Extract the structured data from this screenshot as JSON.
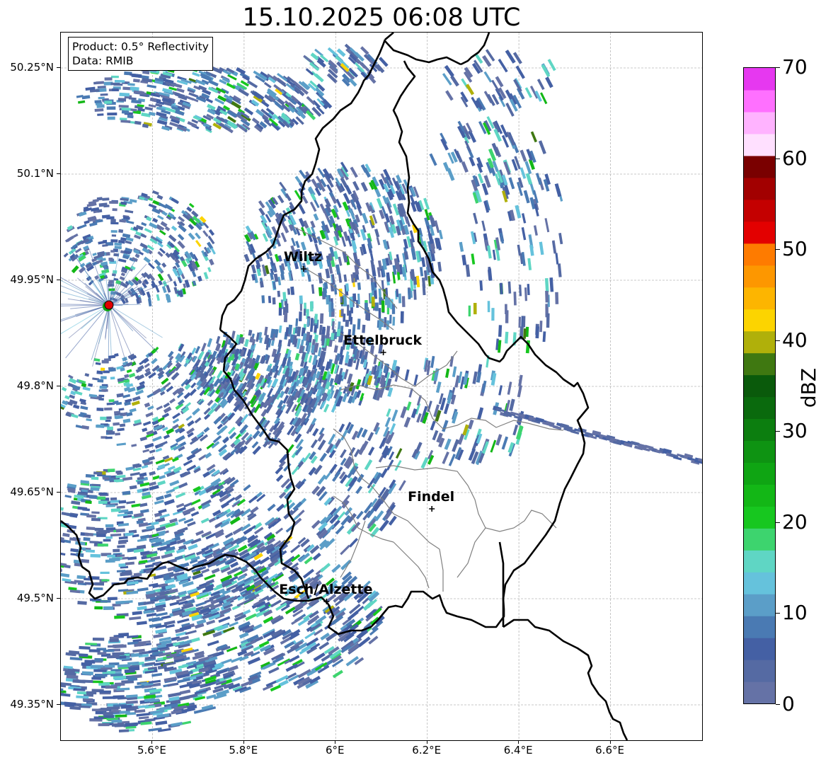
{
  "title": "15.10.2025 06:08 UTC",
  "info": {
    "product": "Product: 0.5° Reflectivity",
    "data": "Data: RMIB"
  },
  "axes": {
    "lat_labels": [
      "50.25°N",
      "50.1°N",
      "49.95°N",
      "49.8°N",
      "49.65°N",
      "49.5°N",
      "49.35°N"
    ],
    "lat_values": [
      50.25,
      50.1,
      49.95,
      49.8,
      49.65,
      49.5,
      49.35
    ],
    "lon_labels": [
      "5.6°E",
      "5.8°E",
      "6°E",
      "6.2°E",
      "6.4°E",
      "6.6°E"
    ],
    "lon_values": [
      5.6,
      5.8,
      6.0,
      6.2,
      6.4,
      6.6
    ],
    "lon_range": [
      5.4,
      6.8
    ],
    "lat_range": [
      49.3,
      50.3
    ],
    "grid": true
  },
  "colorbar": {
    "label": "dBZ",
    "min": 0,
    "max": 70,
    "step": 2.5,
    "tick_labels": [
      "0",
      "10",
      "20",
      "30",
      "40",
      "50",
      "60",
      "70"
    ],
    "tick_values": [
      0,
      10,
      20,
      30,
      40,
      50,
      60,
      70
    ],
    "colors": [
      "#6572a6",
      "#556aa3",
      "#4460a4",
      "#4a7ab3",
      "#5b9ec8",
      "#65c2dc",
      "#5fd6c4",
      "#3dd46e",
      "#17c71f",
      "#13b716",
      "#0fa513",
      "#0e9312",
      "#0c7e0f",
      "#0a6a0d",
      "#0a5a0b",
      "#3f7811",
      "#b0b00a",
      "#fcd400",
      "#fdb500",
      "#fd9700",
      "#fe7b00",
      "#e30000",
      "#c40000",
      "#a20000",
      "#7a0000",
      "#ffe0ff",
      "#ffb3ff",
      "#ff70ff",
      "#e638f0"
    ]
  },
  "radar": {
    "name": "RMIB radar",
    "lon": 5.505,
    "lat": 49.915,
    "color": "#e00000"
  },
  "cities": [
    {
      "name": "Wiltz",
      "lon": 5.93,
      "lat": 49.966
    },
    {
      "name": "Ettelbruck",
      "lon": 6.104,
      "lat": 49.848
    },
    {
      "name": "Findel",
      "lon": 6.21,
      "lat": 49.627
    },
    {
      "name": "Esch/Alzette",
      "lon": 5.98,
      "lat": 49.496
    }
  ]
}
